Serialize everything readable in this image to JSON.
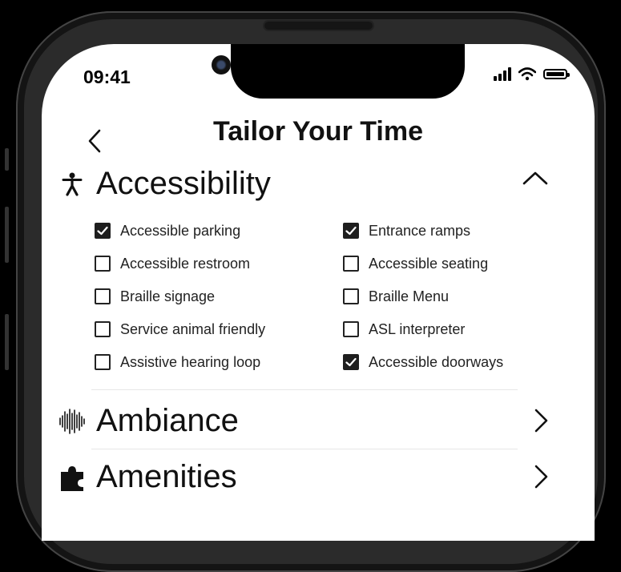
{
  "status_bar": {
    "time": "09:41",
    "icons": [
      "signal-icon",
      "wifi-icon",
      "battery-icon"
    ]
  },
  "header": {
    "back_icon": "chevron-left-icon",
    "title": "Tailor Your Time"
  },
  "sections": [
    {
      "title": "Accessibility",
      "icon": "accessibility-person-icon",
      "state": "expanded",
      "options": [
        {
          "label": "Accessible parking",
          "checked": true
        },
        {
          "label": "Entrance ramps",
          "checked": true
        },
        {
          "label": "Accessible restroom",
          "checked": false
        },
        {
          "label": "Accessible seating",
          "checked": false
        },
        {
          "label": "Braille signage",
          "checked": false
        },
        {
          "label": "Braille Menu",
          "checked": false
        },
        {
          "label": "Service animal friendly",
          "checked": false
        },
        {
          "label": "ASL interpreter",
          "checked": false
        },
        {
          "label": "Assistive hearing loop",
          "checked": false
        },
        {
          "label": "Accessible doorways",
          "checked": true
        }
      ]
    },
    {
      "title": "Ambiance",
      "icon": "sound-wave-icon",
      "state": "collapsed"
    },
    {
      "title": "Amenities",
      "icon": "puzzle-piece-icon",
      "state": "collapsed"
    }
  ],
  "colors": {
    "background": "#000000",
    "screen": "#ffffff",
    "text": "#111111",
    "checkbox_checked": "#1e1e1e"
  }
}
